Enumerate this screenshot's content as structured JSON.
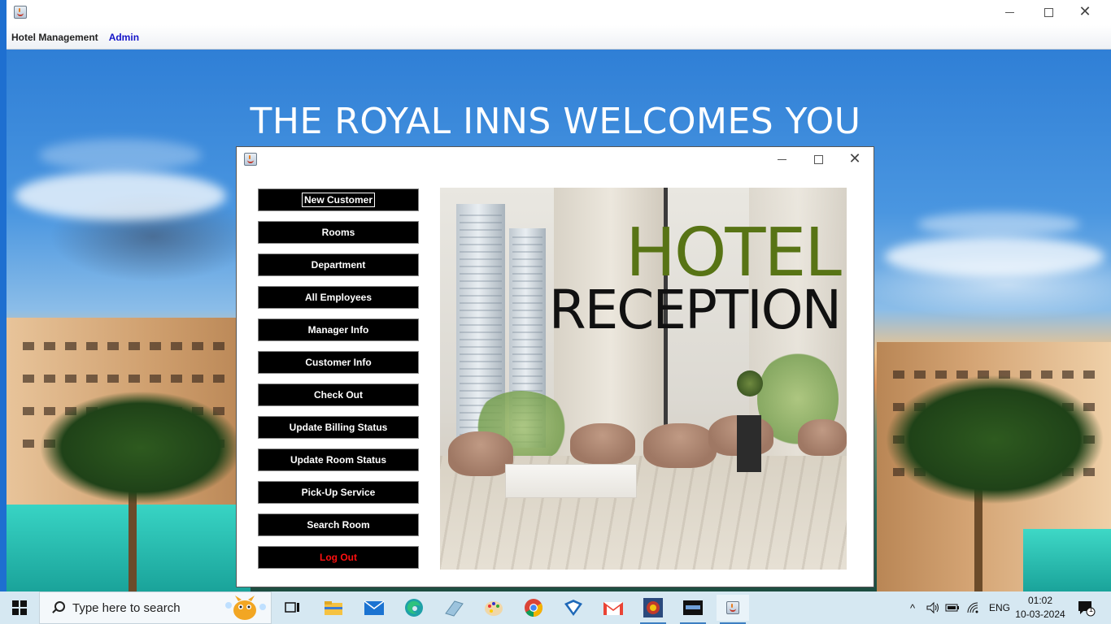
{
  "outer_window": {
    "menu": {
      "hotel": "Hotel Management",
      "admin": "Admin"
    },
    "welcome": "THE ROYAL INNS WELCOMES YOU"
  },
  "dialog": {
    "buttons": [
      {
        "label": "New Customer"
      },
      {
        "label": "Rooms"
      },
      {
        "label": "Department"
      },
      {
        "label": "All Employees"
      },
      {
        "label": "Manager Info"
      },
      {
        "label": "Customer Info"
      },
      {
        "label": "Check Out"
      },
      {
        "label": "Update Billing Status"
      },
      {
        "label": "Update Room Status"
      },
      {
        "label": "Pick-Up Service"
      },
      {
        "label": "Search Room"
      },
      {
        "label": "Log Out"
      }
    ],
    "image": {
      "line1": "HOTEL",
      "line2": "RECEPTION"
    }
  },
  "taskbar": {
    "search_placeholder": "Type here to search",
    "language": "ENG",
    "time": "01:02",
    "date": "10-03-2024",
    "notification_count": "1",
    "apps": [
      "task-view",
      "file-explorer",
      "mail",
      "edge",
      "app",
      "paint",
      "chrome",
      "app",
      "gmail",
      "mysql",
      "mysql-shell",
      "java"
    ]
  },
  "colors": {
    "accent_green": "#587415",
    "logout_red": "#ff1010",
    "menu_admin_blue": "#1414c8"
  }
}
